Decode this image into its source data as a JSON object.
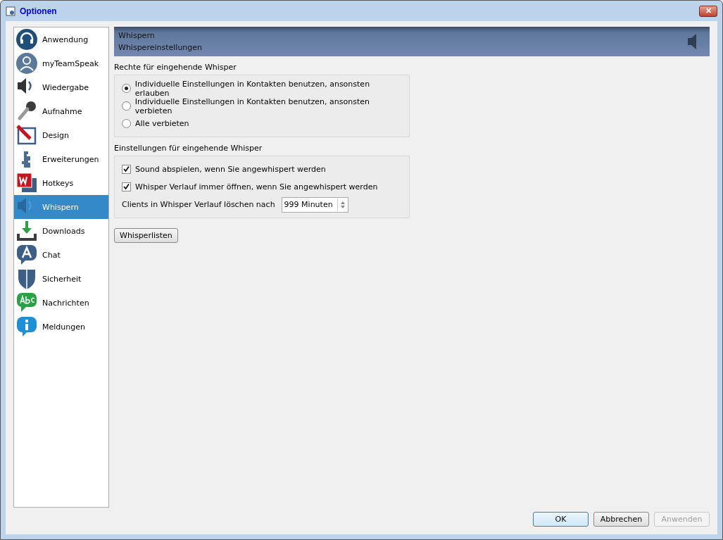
{
  "window": {
    "title": "Optionen",
    "close_label": "✕"
  },
  "sidebar": {
    "items": [
      {
        "label": "Anwendung",
        "selected": false
      },
      {
        "label": "myTeamSpeak",
        "selected": false
      },
      {
        "label": "Wiedergabe",
        "selected": false
      },
      {
        "label": "Aufnahme",
        "selected": false
      },
      {
        "label": "Design",
        "selected": false
      },
      {
        "label": "Erweiterungen",
        "selected": false
      },
      {
        "label": "Hotkeys",
        "selected": false
      },
      {
        "label": "Whispern",
        "selected": true
      },
      {
        "label": "Downloads",
        "selected": false
      },
      {
        "label": "Chat",
        "selected": false
      },
      {
        "label": "Sicherheit",
        "selected": false
      },
      {
        "label": "Nachrichten",
        "selected": false
      },
      {
        "label": "Meldungen",
        "selected": false
      }
    ]
  },
  "header": {
    "title": "Whispern",
    "subtitle": "Whispereinstellungen"
  },
  "rights_group": {
    "label": "Rechte für eingehende Whisper",
    "options": [
      {
        "label": "Individuelle Einstellungen in Kontakten benutzen, ansonsten erlauben",
        "selected": true
      },
      {
        "label": "Individuelle Einstellungen in Kontakten benutzen, ansonsten verbieten",
        "selected": false
      },
      {
        "label": "Alle verbieten",
        "selected": false
      }
    ]
  },
  "settings_group": {
    "label": "Einstellungen für eingehende Whisper",
    "checkboxes": [
      {
        "label": "Sound abspielen, wenn Sie angewhispert werden",
        "checked": true
      },
      {
        "label": "Whisper Verlauf immer öffnen, wenn Sie angewhispert werden",
        "checked": true
      }
    ],
    "spin_label": "Clients in Whisper Verlauf löschen nach",
    "spin_value": "999 Minuten"
  },
  "whisperlist_button": "Whisperlisten",
  "buttons": [
    {
      "label": "OK",
      "default": true,
      "disabled": false
    },
    {
      "label": "Abbrechen",
      "default": false,
      "disabled": false
    },
    {
      "label": "Anwenden",
      "default": false,
      "disabled": true
    }
  ]
}
